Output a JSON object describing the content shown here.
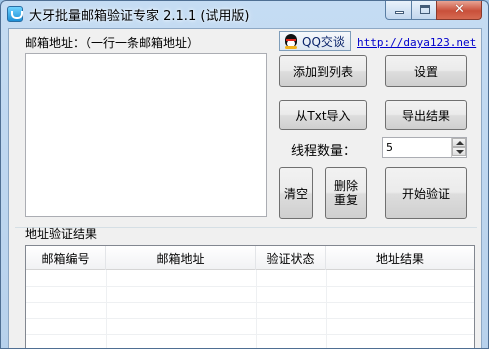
{
  "window": {
    "title": "大牙批量邮箱验证专家 2.1.1 (试用版)",
    "controls": {
      "minimize": "minimize",
      "maximize": "maximize",
      "close": "✕"
    }
  },
  "input_section": {
    "label": "邮箱地址：（一行一条邮箱地址）",
    "textarea_value": ""
  },
  "contact": {
    "qq_label": "QQ交谈",
    "website": "http://daya123.net"
  },
  "buttons": {
    "add_to_list": "添加到列表",
    "settings": "设置",
    "import_txt": "从Txt导入",
    "export_results": "导出结果",
    "clear": "清空",
    "remove_duplicates": "删除重复",
    "start_verify": "开始验证"
  },
  "threads": {
    "label": "线程数量：",
    "value": "5"
  },
  "results": {
    "group_label": "地址验证结果",
    "columns": [
      "邮箱编号",
      "邮箱地址",
      "验证状态",
      "地址结果"
    ],
    "rows": []
  },
  "colors": {
    "title_bar": "#b7d1ec",
    "client_bg": "#f0f0f0",
    "link": "#0000cc",
    "close_button": "#c9503a"
  },
  "icons": [
    "app-icon",
    "qq-penguin-icon",
    "minimize-icon",
    "maximize-icon",
    "close-icon",
    "spin-up-icon",
    "spin-down-icon"
  ]
}
